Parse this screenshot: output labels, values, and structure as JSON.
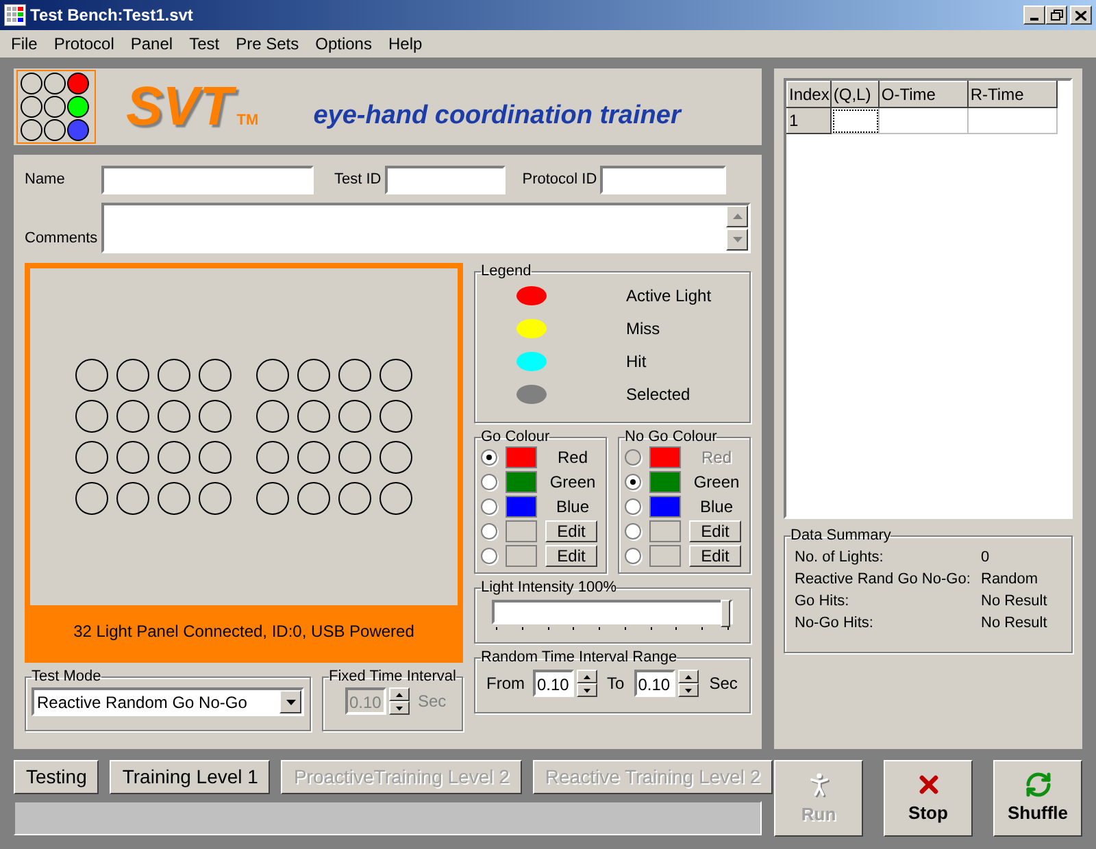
{
  "window": {
    "title": "Test Bench:Test1.svt"
  },
  "menu": [
    "File",
    "Protocol",
    "Panel",
    "Test",
    "Pre Sets",
    "Options",
    "Help"
  ],
  "header": {
    "logo": "SVT",
    "trademark": "TM",
    "tagline": "eye-hand coordination trainer"
  },
  "form": {
    "name_label": "Name",
    "test_id_label": "Test ID",
    "protocol_id_label": "Protocol ID",
    "comments_label": "Comments"
  },
  "light_panel": {
    "status": "32 Light Panel Connected, ID:0, USB Powered"
  },
  "legend": {
    "title": "Legend",
    "items": [
      {
        "label": "Active Light",
        "color": "#ff0000"
      },
      {
        "label": "Miss",
        "color": "#ffff00"
      },
      {
        "label": "Hit",
        "color": "#00ffff"
      },
      {
        "label": "Selected",
        "color": "#808080"
      }
    ]
  },
  "go_colour": {
    "title": "Go Colour",
    "options": [
      {
        "kind": "swatch",
        "label": "Red",
        "color": "#ff0000",
        "selected": true,
        "disabled": false
      },
      {
        "kind": "swatch",
        "label": "Green",
        "color": "#008000",
        "selected": false,
        "disabled": false
      },
      {
        "kind": "swatch",
        "label": "Blue",
        "color": "#0000ff",
        "selected": false,
        "disabled": false
      },
      {
        "kind": "edit",
        "label": "Edit",
        "selected": false,
        "disabled": false
      },
      {
        "kind": "edit",
        "label": "Edit",
        "selected": false,
        "disabled": false
      }
    ]
  },
  "no_go_colour": {
    "title": "No Go Colour",
    "options": [
      {
        "kind": "swatch",
        "label": "Red",
        "color": "#ff0000",
        "selected": false,
        "disabled": true
      },
      {
        "kind": "swatch",
        "label": "Green",
        "color": "#008000",
        "selected": true,
        "disabled": false
      },
      {
        "kind": "swatch",
        "label": "Blue",
        "color": "#0000ff",
        "selected": false,
        "disabled": false
      },
      {
        "kind": "edit",
        "label": "Edit",
        "selected": false,
        "disabled": false
      },
      {
        "kind": "edit",
        "label": "Edit",
        "selected": false,
        "disabled": false
      }
    ]
  },
  "light_intensity": {
    "title": "Light Intensity 100%",
    "level": 1
  },
  "test_mode": {
    "title": "Test Mode",
    "value": "Reactive Random Go No-Go"
  },
  "fixed_interval": {
    "title": "Fixed Time Interval",
    "value": "0.10",
    "unit": "Sec",
    "disabled": true
  },
  "random_interval": {
    "title": "Random Time Interval Range",
    "from_label": "From",
    "from_value": "0.10",
    "to_label": "To",
    "to_value": "0.10",
    "unit": "Sec"
  },
  "mode_buttons": [
    {
      "label": "Testing",
      "disabled": false
    },
    {
      "label": "Training Level 1",
      "disabled": false
    },
    {
      "label": "ProactiveTraining Level 2",
      "disabled": true
    },
    {
      "label": "Reactive Training Level 2",
      "disabled": true
    }
  ],
  "table": {
    "columns": [
      "Index",
      "(Q,L)",
      "O-Time",
      "R-Time"
    ],
    "rows": [
      [
        "1",
        "",
        "",
        ""
      ]
    ]
  },
  "data_summary": {
    "title": "Data Summary",
    "rows": [
      {
        "label": "No. of Lights:",
        "value": "0"
      },
      {
        "label": "Reactive Rand Go No-Go:",
        "value": "Random"
      },
      {
        "label": "Go Hits:",
        "value": "No Result"
      },
      {
        "label": "No-Go Hits:",
        "value": "No Result"
      }
    ]
  },
  "actions": [
    {
      "kind": "run",
      "label": "Run",
      "disabled": true
    },
    {
      "kind": "stop",
      "label": "Stop",
      "disabled": false
    },
    {
      "kind": "shuffle",
      "label": "Shuffle",
      "disabled": false
    }
  ]
}
